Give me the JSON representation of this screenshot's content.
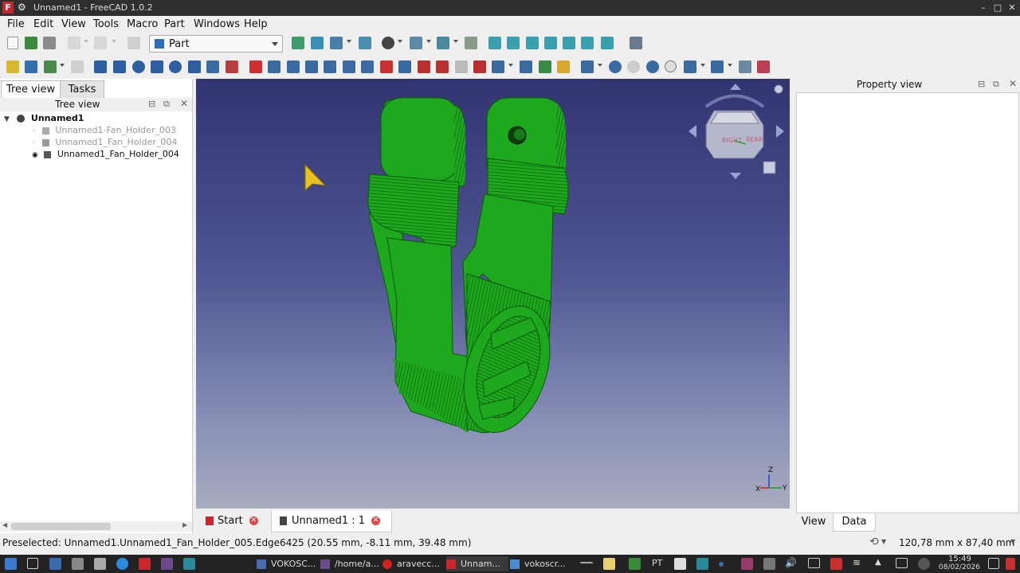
{
  "window": {
    "title": "Unnamed1 - FreeCAD 1.0.2",
    "minimize": "–",
    "maximize": "□",
    "close": "✕"
  },
  "menubar": {
    "items": [
      "File",
      "Edit",
      "View",
      "Tools",
      "Macro",
      "Part",
      "Windows",
      "Help"
    ]
  },
  "toolbar": {
    "workbench": "Part"
  },
  "left_panel": {
    "tabs": [
      "Tree view",
      "Tasks"
    ],
    "header": "Tree view",
    "root": "Unnamed1",
    "items": [
      "Unnamed1-Fan_Holder_003",
      "Unnamed1_Fan_Holder_004",
      "Unnamed1_Fan_Holder_004"
    ]
  },
  "viewport": {
    "axis_x": "X",
    "axis_y": "Y",
    "axis_z": "Z",
    "navcube_face_right": "RIGHT",
    "navcube_face_rear": "REAR"
  },
  "doc_tabs": [
    "Start",
    "Unnamed1 : 1"
  ],
  "property_view": {
    "title": "Property view",
    "tabs": [
      "View",
      "Data"
    ]
  },
  "status": {
    "message": "Preselected: Unnamed1.Unnamed1_Fan_Holder_005.Edge6425 (20.55 mm, -8.11 mm, 39.48 mm)",
    "dimensions": "120,78 mm x 87,40 mm"
  },
  "taskbar": {
    "tasks": [
      "VOKOSC...",
      "/home/a...",
      "aravecc...",
      "Unnam...",
      "vokoscr..."
    ],
    "lang": "PT",
    "time": "15:49",
    "date": "08/02/2026"
  },
  "colors": {
    "model": "#1ea81e",
    "viewport_top": "#323470",
    "viewport_bottom": "#a8acbf",
    "accent": "#c8262c"
  }
}
